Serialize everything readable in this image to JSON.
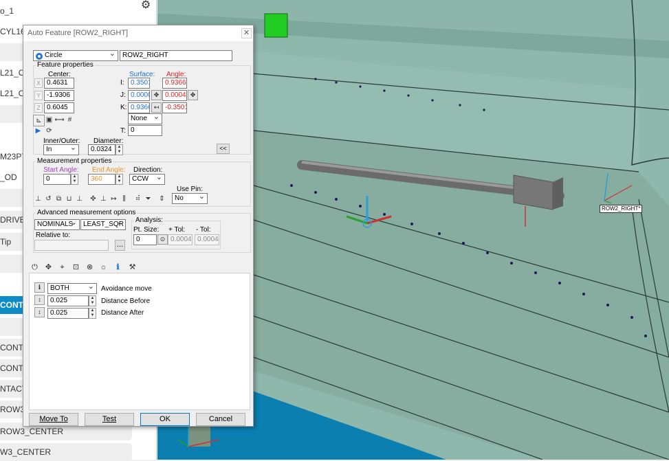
{
  "left_panel": {
    "items": [
      {
        "label": "o_1",
        "style": "plain"
      },
      {
        "label": "CYL16_",
        "style": "plain"
      },
      {
        "label": "",
        "style": "item"
      },
      {
        "label": "L21_O",
        "style": "plain"
      },
      {
        "label": "L21_O",
        "style": "plain"
      },
      {
        "label": "",
        "style": "item"
      },
      {
        "label": "M23PT",
        "style": "plain"
      },
      {
        "label": "_OD",
        "style": "plain"
      },
      {
        "label": "",
        "style": "item"
      },
      {
        "label": "DRIVE",
        "style": "item"
      },
      {
        "label": "Tip",
        "style": "item"
      },
      {
        "label": "",
        "style": "item"
      },
      {
        "label": "CONTAC",
        "style": "active"
      },
      {
        "label": "",
        "style": "item"
      },
      {
        "label": "CONTAC",
        "style": "item"
      },
      {
        "label": "CONTA",
        "style": "item"
      },
      {
        "label": "NTACT)",
        "style": "item"
      },
      {
        "label": "ROW3_R",
        "style": "item"
      },
      {
        "label": "ROW3_CENTER",
        "style": "item"
      },
      {
        "label": "W3_CENTER",
        "style": "item"
      }
    ],
    "gear_icon": "gear-icon"
  },
  "view3d": {
    "label_tag": "ROW2_RIGHT*",
    "colors": {
      "background": "#0a7fb0",
      "part": "#8fb8ac",
      "highlight": "#22cc22"
    }
  },
  "dialog": {
    "title": "Auto Feature [ROW2_RIGHT]",
    "close": "✕",
    "feature_type": "Circle",
    "feature_name": "ROW2_RIGHT",
    "feature_properties": {
      "group_title": "Feature properties",
      "center_label": "Center:",
      "x_axis": "X",
      "y_axis": "Y",
      "z_axis": "Z",
      "x": "0.4631",
      "y": "-1.9306",
      "z": "0.6045",
      "surface_label": "Surface:",
      "angle_label": "Angle:",
      "i_label": "I:",
      "j_label": "J:",
      "k_label": "K:",
      "surface_i": "0.3501",
      "surface_j": "0.0000",
      "surface_k": "0.9366",
      "angle_i": "0.9366",
      "angle_j": "0.0004",
      "angle_k": "-0.3501",
      "none_option": "None",
      "t_label": "T:",
      "t_value": "0",
      "inner_outer_label": "Inner/Outer:",
      "inner_outer": "In",
      "diameter_label": "Diameter:",
      "diameter": "0.0324",
      "collapse_btn": "<<"
    },
    "measurement_properties": {
      "group_title": "Measurement properties",
      "start_angle_label": "Start Angle:",
      "start_angle": "0",
      "end_angle_label": "End Angle:",
      "end_angle": "360",
      "direction_label": "Direction:",
      "direction": "CCW",
      "use_pin_label": "Use Pin:",
      "use_pin": "No"
    },
    "advanced": {
      "group_title": "Advanced measurement options",
      "nominals": "NOMINALS",
      "fit": "LEAST_SQR",
      "relative_to_label": "Relative to:",
      "relative_to": "",
      "browse": "...",
      "analysis_title": "Analysis:",
      "pt_size_label": "Pt. Size:",
      "pt_size": "0",
      "plus_tol_label": "+ Tol:",
      "plus_tol": "0.0004",
      "minus_tol_label": "- Tol:",
      "minus_tol": "0.0004"
    },
    "tab_icons": [
      "power-icon",
      "move-icon",
      "target-icon",
      "screen-icon",
      "cancel-circle-icon",
      "sun-icon",
      "info-icon",
      "tool-icon"
    ],
    "avoidance": {
      "mode": "BOTH",
      "mode_label": "Avoidance move",
      "before": "0.025",
      "before_label": "Distance Before",
      "after": "0.025",
      "after_label": "Distance After"
    },
    "buttons": {
      "move_to": "Move To",
      "test": "Test",
      "ok": "OK",
      "cancel": "Cancel"
    }
  }
}
